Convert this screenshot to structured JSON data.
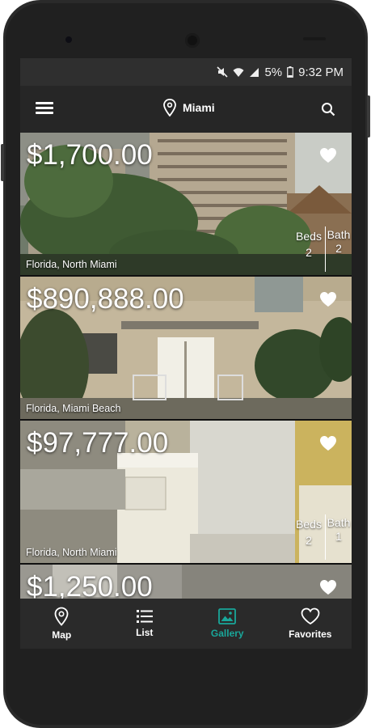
{
  "status_bar": {
    "battery": "5%",
    "time": "9:32 PM"
  },
  "app_bar": {
    "location": "Miami"
  },
  "listings": [
    {
      "price": "$1,700.00",
      "location": "Florida, North Miami",
      "beds_label": "Beds",
      "beds": "2",
      "bath_label": "Bath",
      "baths": "2"
    },
    {
      "price": "$890,888.00",
      "location": "Florida, Miami Beach"
    },
    {
      "price": "$97,777.00",
      "location": "Florida, North Miami",
      "beds_label": "Beds",
      "beds": "2",
      "bath_label": "Bath",
      "baths": "1"
    },
    {
      "price": "$1,250.00"
    }
  ],
  "bottom_nav": {
    "items": [
      {
        "label": "Map",
        "icon": "map-pin-icon"
      },
      {
        "label": "List",
        "icon": "list-icon"
      },
      {
        "label": "Gallery",
        "icon": "gallery-icon",
        "active": true
      },
      {
        "label": "Favorites",
        "icon": "heart-outline-icon"
      }
    ]
  },
  "colors": {
    "accent": "#19a79a",
    "app_bar": "#262626",
    "nav_bar": "#2a2a2a"
  }
}
